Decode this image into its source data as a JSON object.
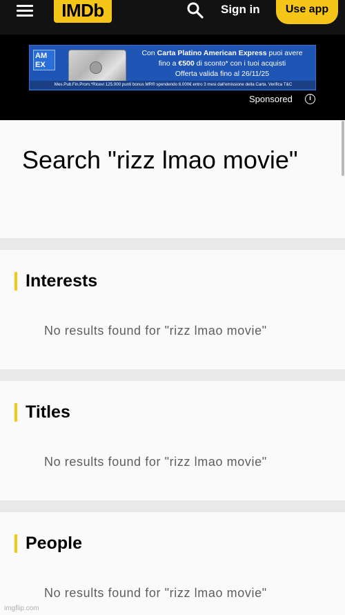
{
  "header": {
    "logo": "IMDb",
    "sign_in": "Sign in",
    "use_app": "Use app",
    "menu_icon": "hamburger-menu-icon",
    "search_icon": "search-icon"
  },
  "ad": {
    "amex_logo_text": "AM EX",
    "line1_prefix": "Con ",
    "line1_bold": "Carta Platino American Express",
    "line1_suffix": " puoi avere",
    "line2_prefix": "fino a ",
    "line2_bold": "€500",
    "line2_suffix": " di sconto* con i tuoi acquisti",
    "line3": "Offerta valida fino al 26/11/25",
    "fine_print": "Mes.Pub.Fin.Prom.*Ricevi 125.000 punti bonus MR® spendendo 6.000€ entro 3 mesi dall'emissione della Carta. Verifica T&C",
    "sponsored": "Sponsored"
  },
  "search": {
    "title": "Search \"rizz lmao movie\""
  },
  "sections": [
    {
      "heading": "Interests",
      "empty_text": "No results found for \"rizz lmao movie\""
    },
    {
      "heading": "Titles",
      "empty_text": "No results found for \"rizz lmao movie\""
    },
    {
      "heading": "People",
      "empty_text": "No results found for \"rizz lmao movie\""
    }
  ],
  "watermark": "imgflip.com",
  "colors": {
    "brand_yellow": "#f5c518",
    "header_bg": "#121212",
    "ad_blue": "#1f55b4"
  }
}
